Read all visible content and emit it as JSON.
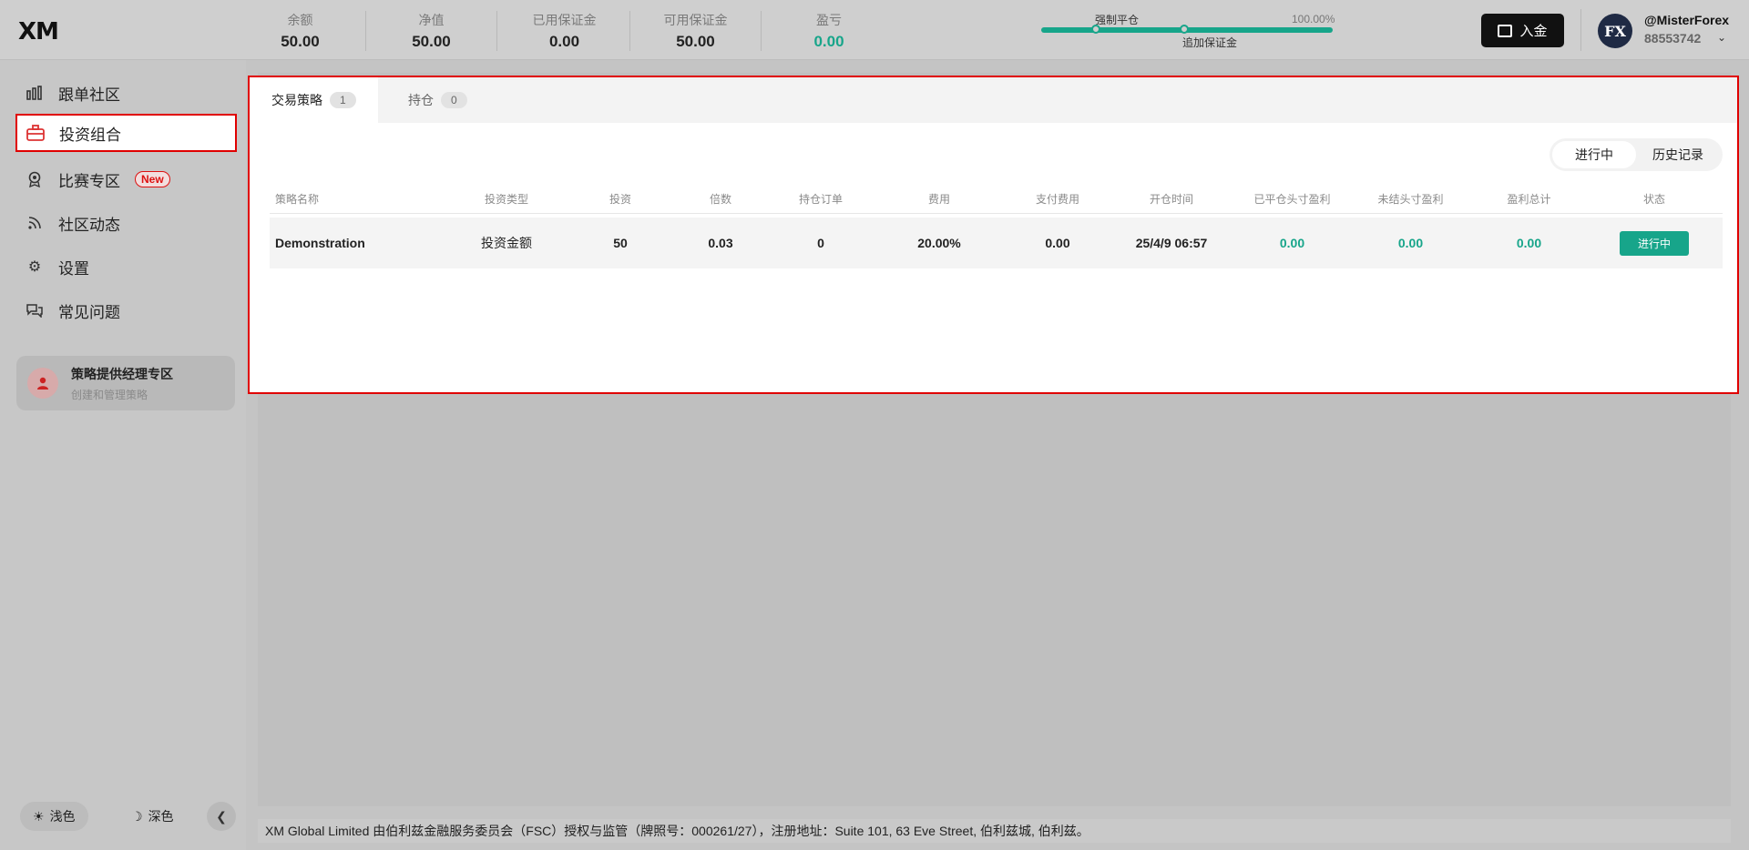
{
  "header": {
    "logo": "XM",
    "stats": [
      {
        "label": "余额",
        "value": "50.00"
      },
      {
        "label": "净值",
        "value": "50.00"
      },
      {
        "label": "已用保证金",
        "value": "0.00"
      },
      {
        "label": "可用保证金",
        "value": "50.00"
      },
      {
        "label": "盈亏",
        "value": "0.00"
      }
    ],
    "margin_level": {
      "stop_out_label": "强制平仓",
      "margin_call_label": "追加保证金",
      "percent": "100.00%"
    },
    "deposit_label": "入金",
    "user": {
      "avatar_text": "FX",
      "name": "@MisterForex",
      "id": "88553742"
    }
  },
  "sidebar": {
    "items": [
      {
        "label": "跟单社区",
        "icon": "bar-chart-icon"
      },
      {
        "label": "投资组合",
        "icon": "briefcase-icon",
        "active": true
      },
      {
        "label": "比赛专区",
        "icon": "award-icon",
        "badge": "New"
      },
      {
        "label": "社区动态",
        "icon": "rss-icon"
      },
      {
        "label": "设置",
        "icon": "gear-icon"
      },
      {
        "label": "常见问题",
        "icon": "chat-icon"
      }
    ],
    "manager_card": {
      "title": "策略提供经理专区",
      "subtitle": "创建和管理策略"
    },
    "theme_light": "浅色",
    "theme_dark": "深色"
  },
  "main": {
    "tabs": [
      {
        "label": "交易策略",
        "count": "1"
      },
      {
        "label": "持仓",
        "count": "0"
      }
    ],
    "segment": {
      "active": "进行中",
      "history": "历史记录"
    },
    "columns": [
      "策略名称",
      "投资类型",
      "投资",
      "倍数",
      "持仓订单",
      "费用",
      "支付费用",
      "开仓时间",
      "已平仓头寸盈利",
      "未结头寸盈利",
      "盈利总计",
      "状态"
    ],
    "rows": [
      [
        "Demonstration",
        "投资金额",
        "50",
        "0.03",
        "0",
        "20.00%",
        "0.00",
        "25/4/9 06:57",
        "0.00",
        "0.00",
        "0.00",
        "进行中"
      ]
    ]
  },
  "footer": {
    "text": "XM Global Limited 由伯利兹金融服务委员会（FSC）授权与监管（牌照号：000261/27），注册地址：Suite 101, 63 Eve Street, 伯利兹城, 伯利兹。"
  },
  "colors": {
    "accent": "#17a58a",
    "highlight": "#e00000"
  }
}
